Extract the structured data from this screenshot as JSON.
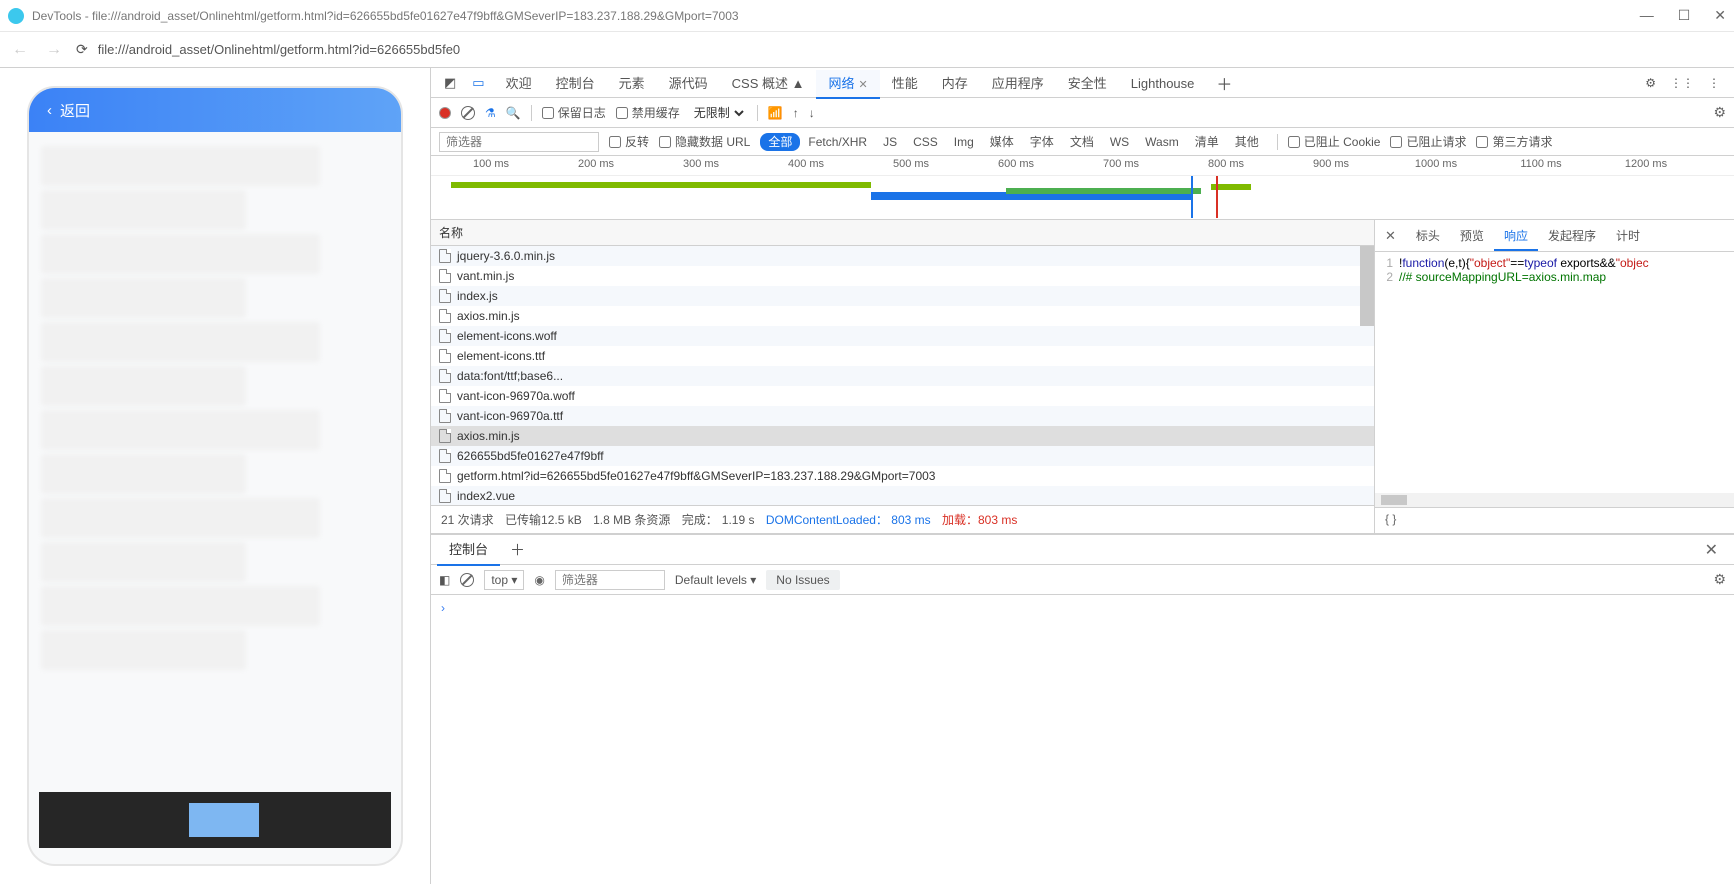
{
  "window": {
    "title": "DevTools - file:///android_asset/Onlinehtml/getform.html?id=626655bd5fe01627e47f9bff&GMSeverIP=183.237.188.29&GMport=7003"
  },
  "toolbar": {
    "url": "file:///android_asset/Onlinehtml/getform.html?id=626655bd5fe0"
  },
  "device": {
    "back_label": "返回"
  },
  "devtools": {
    "tabs": [
      "欢迎",
      "控制台",
      "元素",
      "源代码",
      "CSS 概述",
      "网络",
      "性能",
      "内存",
      "应用程序",
      "安全性",
      "Lighthouse"
    ],
    "active_tab": "网络",
    "css_overview_suffix": " ▲"
  },
  "network_toolbar": {
    "preserve_log": "保留日志",
    "disable_cache": "禁用缓存",
    "throttling": "无限制"
  },
  "filter_bar": {
    "placeholder": "筛选器",
    "invert": "反转",
    "hide_data_urls": "隐藏数据 URL",
    "types": [
      "全部",
      "Fetch/XHR",
      "JS",
      "CSS",
      "Img",
      "媒体",
      "字体",
      "文档",
      "WS",
      "Wasm",
      "清单",
      "其他"
    ],
    "active_type": "全部",
    "blocked_cookies": "已阻止 Cookie",
    "blocked_requests": "已阻止请求",
    "third_party": "第三方请求"
  },
  "timeline": {
    "ticks": [
      "100 ms",
      "200 ms",
      "300 ms",
      "400 ms",
      "500 ms",
      "600 ms",
      "700 ms",
      "800 ms",
      "900 ms",
      "1000 ms",
      "1100 ms",
      "1200 ms"
    ]
  },
  "requests": {
    "header": "名称",
    "rows": [
      "jquery-3.6.0.min.js",
      "vant.min.js",
      "index.js",
      "axios.min.js",
      "element-icons.woff",
      "element-icons.ttf",
      "data:font/ttf;base6...",
      "vant-icon-96970a.woff",
      "vant-icon-96970a.ttf",
      "axios.min.js",
      "626655bd5fe01627e47f9bff",
      "getform.html?id=626655bd5fe01627e47f9bff&GMSeverIP=183.237.188.29&GMport=7003",
      "index2.vue"
    ],
    "selected_index": 9
  },
  "summary": {
    "requests": "21 次请求",
    "transferred": "已传输12.5 kB",
    "resources": "1.8 MB 条资源",
    "finish_label": "完成：",
    "finish_value": "1.19 s",
    "dcl_label": "DOMContentLoaded：",
    "dcl_value": "803 ms",
    "load_label": "加载：",
    "load_value": "803 ms"
  },
  "detail": {
    "tabs": [
      "标头",
      "预览",
      "响应",
      "发起程序",
      "计时"
    ],
    "active_tab": "响应",
    "code_lines": [
      {
        "n": "1",
        "seg": [
          {
            "t": "!",
            "c": ""
          },
          {
            "t": "function",
            "c": "kw-blue"
          },
          {
            "t": "(e,t){",
            "c": ""
          },
          {
            "t": "\"object\"",
            "c": "kw-red"
          },
          {
            "t": "==",
            "c": ""
          },
          {
            "t": "typeof",
            "c": "kw-blue"
          },
          {
            "t": " exports&&",
            "c": ""
          },
          {
            "t": "\"objec",
            "c": "kw-red"
          }
        ]
      },
      {
        "n": "2",
        "seg": [
          {
            "t": "//# sourceMappingURL=axios.min.map",
            "c": "kw-green"
          }
        ]
      }
    ],
    "footer": "{ }"
  },
  "drawer": {
    "tab": "控制台",
    "context": "top",
    "filter_placeholder": "筛选器",
    "levels": "Default levels",
    "no_issues": "No Issues"
  }
}
